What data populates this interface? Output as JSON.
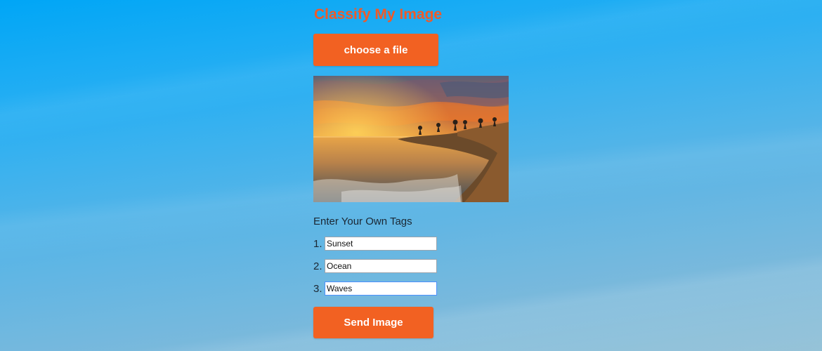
{
  "app": {
    "title": "Classify My Image"
  },
  "upload": {
    "choose_label": "choose a file"
  },
  "preview": {
    "description_icon": "image-preview"
  },
  "tags": {
    "heading": "Enter Your Own Tags",
    "items": [
      {
        "number": "1.",
        "value": "Sunset"
      },
      {
        "number": "2.",
        "value": "Ocean"
      },
      {
        "number": "3.",
        "value": "Waves"
      }
    ]
  },
  "actions": {
    "send_label": "Send Image"
  },
  "colors": {
    "accent": "#f26122",
    "title": "#f05a28"
  }
}
